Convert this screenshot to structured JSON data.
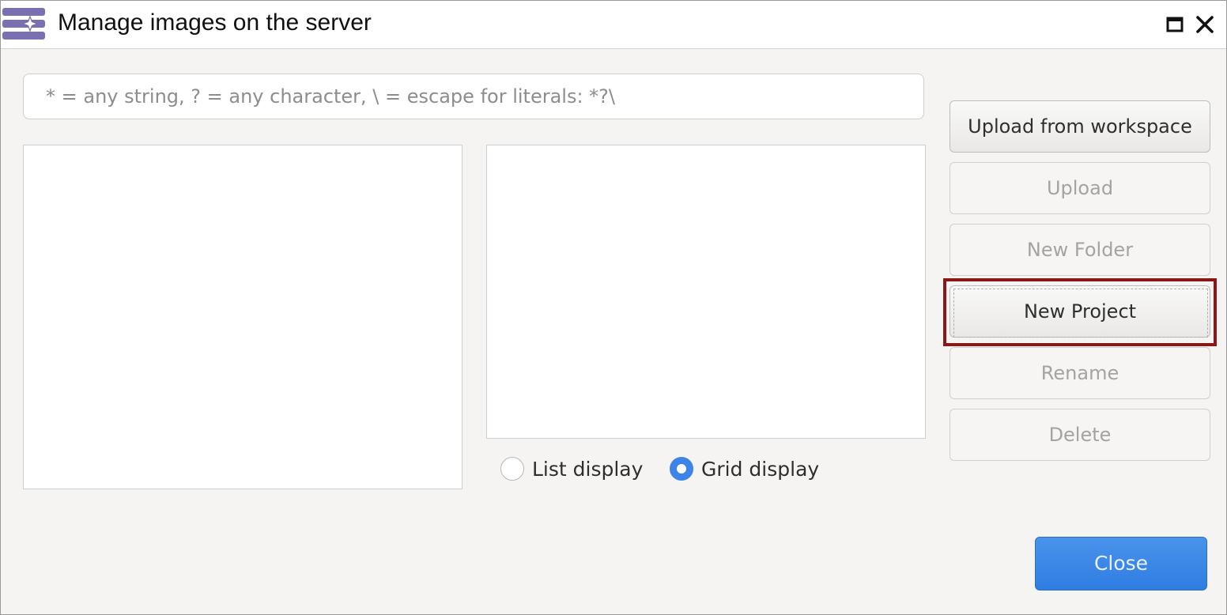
{
  "window": {
    "title": "Manage images on the server",
    "icon": "image-manager-icon"
  },
  "search": {
    "placeholder": "* = any string, ? = any character, \\ = escape for literals: *?\\",
    "value": ""
  },
  "display": {
    "list_label": "List display",
    "grid_label": "Grid display",
    "selected": "grid"
  },
  "actions": {
    "upload_from_workspace": "Upload from workspace",
    "upload": "Upload",
    "new_folder": "New Folder",
    "new_project": "New Project",
    "rename": "Rename",
    "delete": "Delete"
  },
  "footer": {
    "close_label": "Close"
  },
  "colors": {
    "accent": "#3d84e6",
    "focus_highlight": "#8b1616",
    "icon_purple": "#7a6fb0"
  }
}
